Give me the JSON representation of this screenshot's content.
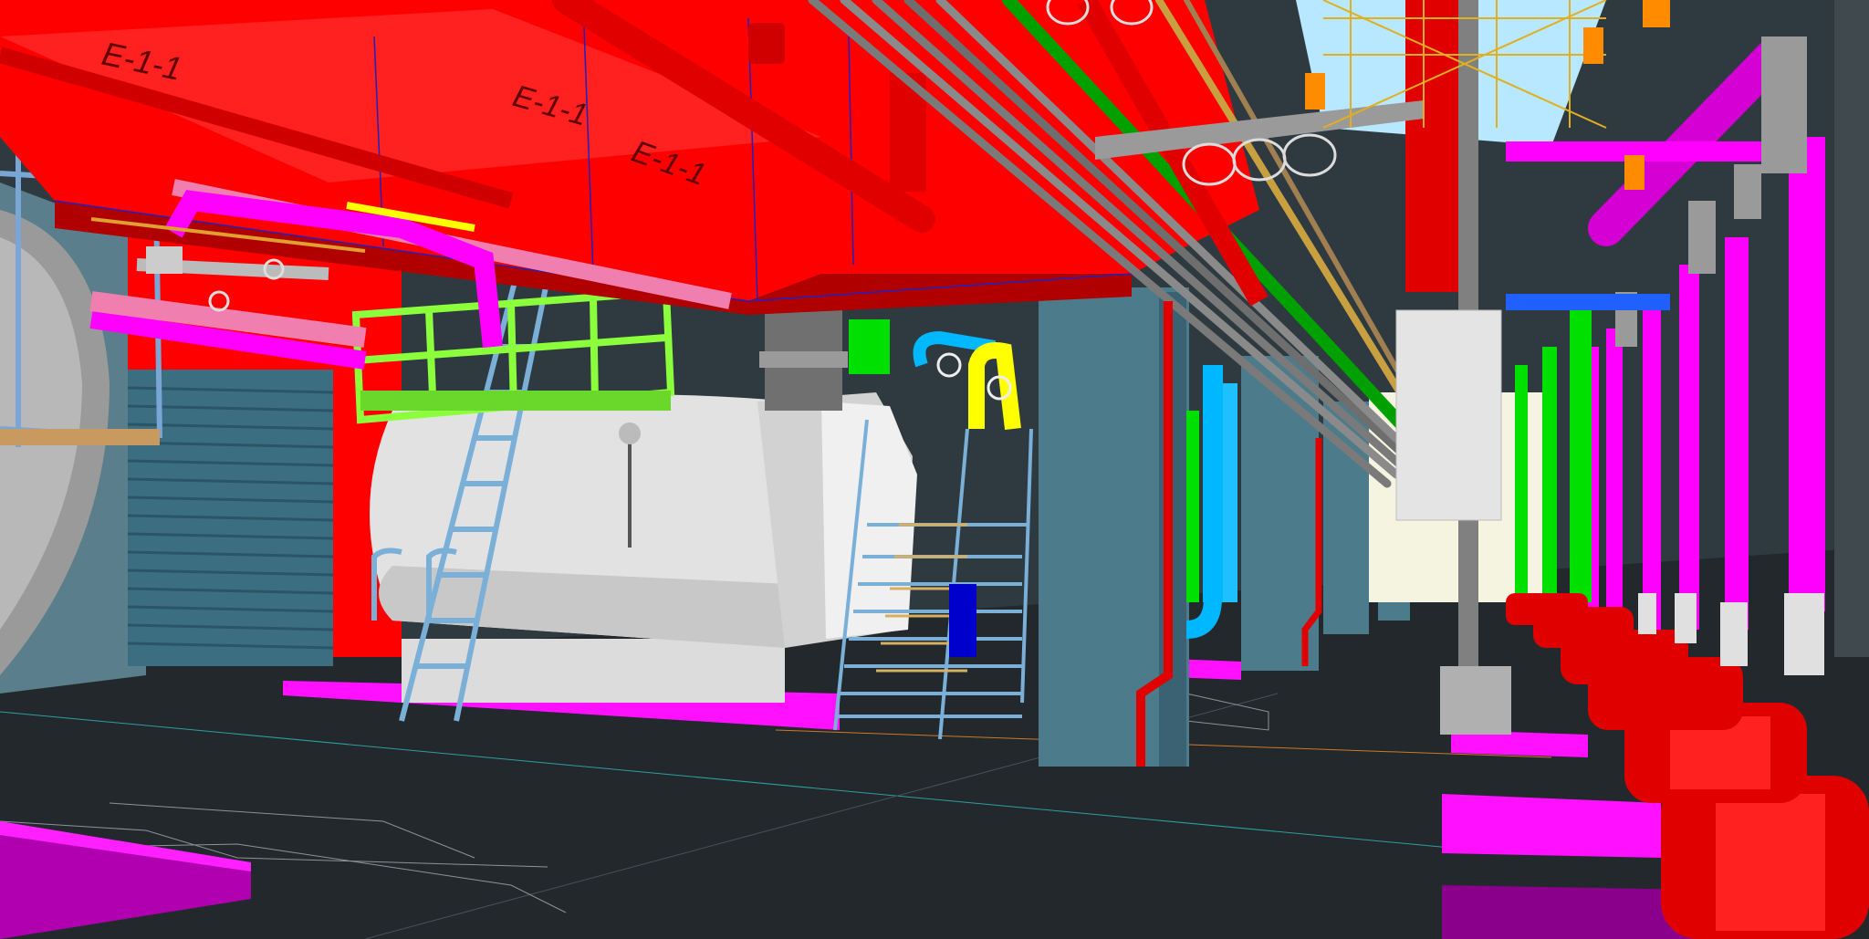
{
  "viewport": {
    "kind": "bim-3d-model-view",
    "background_color": "#23282c"
  },
  "colors": {
    "floor": "#23282c",
    "duct_red": "#ff0000",
    "duct_red_dark": "#c00000",
    "pipe_magenta": "#ff00ff",
    "pipe_green": "#00ff00",
    "pipe_cyan": "#00b8ff",
    "pipe_yellow": "#ffff00",
    "pipe_pink": "#f07fb0",
    "pipe_gray": "#8a8a8a",
    "column_teal": "#4c7b8c",
    "boiler_white": "#e6e6e6",
    "ladder_blue": "#7aa6d6",
    "platform_green": "#8cff3c",
    "floor_pad_magenta": "#ff10ff",
    "cable_tray_yellow": "#d6b43a",
    "structure_orange": "#ff8c00"
  },
  "duct_labels": [
    {
      "id": "duct-label-1",
      "text": "E-1-1"
    },
    {
      "id": "duct-label-2",
      "text": "E-1-1"
    },
    {
      "id": "duct-label-3",
      "text": "E-1-1"
    }
  ],
  "icons": {
    "valve": "valve-handwheel-icon",
    "pump": "pump-motor-icon"
  }
}
